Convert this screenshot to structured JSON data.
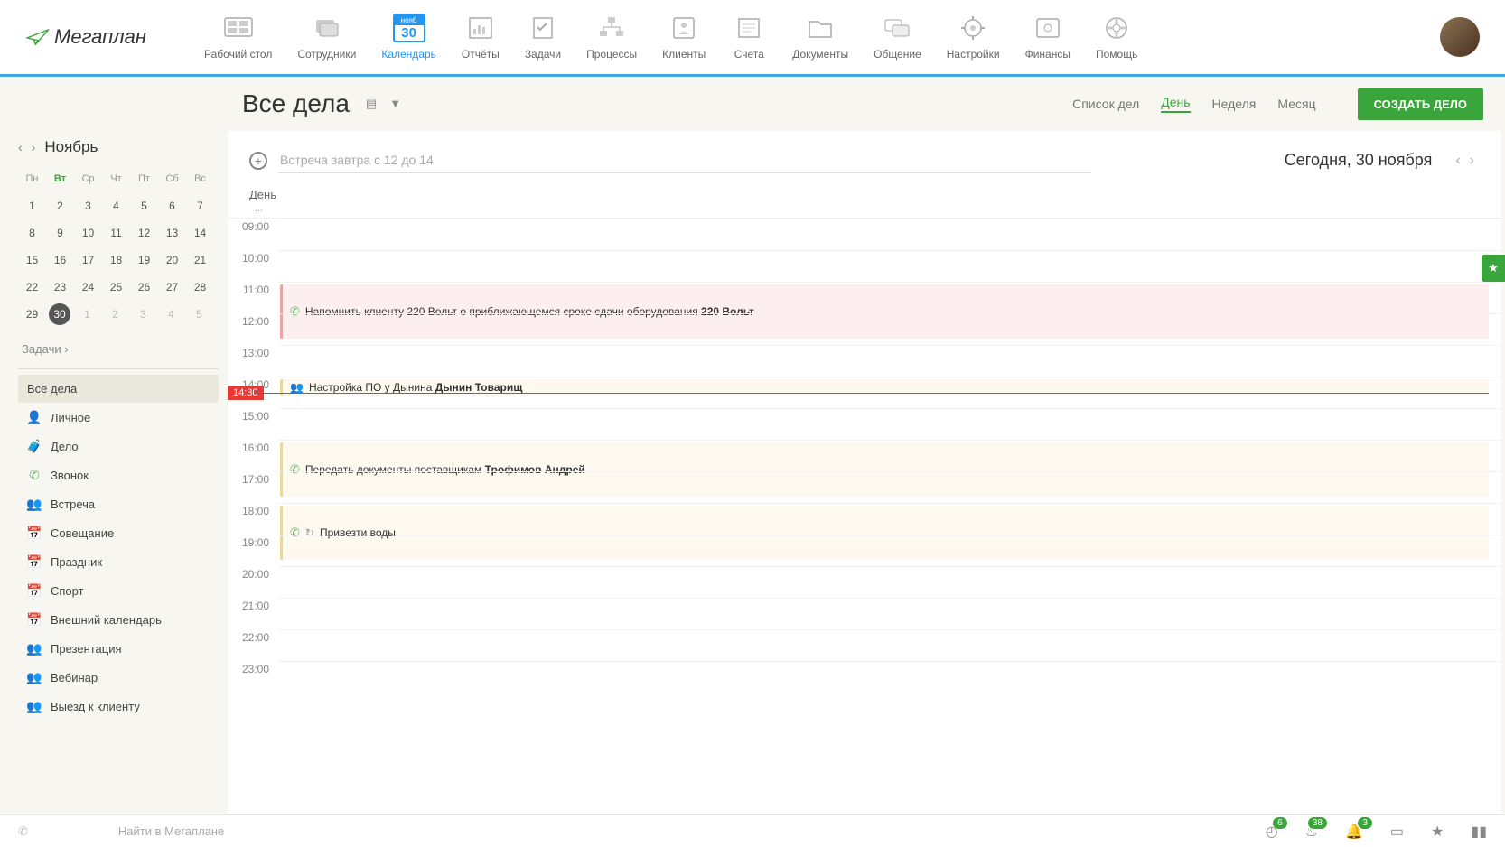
{
  "logo_text": "егаплан",
  "nav": [
    {
      "label": "Рабочий стол"
    },
    {
      "label": "Сотрудники"
    },
    {
      "label": "Календарь",
      "month_short": "нояб",
      "day_num": "30"
    },
    {
      "label": "Отчёты"
    },
    {
      "label": "Задачи"
    },
    {
      "label": "Процессы"
    },
    {
      "label": "Клиенты"
    },
    {
      "label": "Счета"
    },
    {
      "label": "Документы"
    },
    {
      "label": "Общение"
    },
    {
      "label": "Настройки"
    },
    {
      "label": "Финансы"
    },
    {
      "label": "Помощь"
    }
  ],
  "page_title": "Все дела",
  "views": {
    "list": "Список дел",
    "day": "День",
    "week": "Неделя",
    "month": "Месяц"
  },
  "create_btn": "СОЗДАТЬ ДЕЛО",
  "month_name": "Ноябрь",
  "weekdays": [
    "Пн",
    "Вт",
    "Ср",
    "Чт",
    "Пт",
    "Сб",
    "Вс"
  ],
  "mini_cal": [
    [
      "1",
      "2",
      "3",
      "4",
      "5",
      "6",
      "7"
    ],
    [
      "8",
      "9",
      "10",
      "11",
      "12",
      "13",
      "14"
    ],
    [
      "15",
      "16",
      "17",
      "18",
      "19",
      "20",
      "21"
    ],
    [
      "22",
      "23",
      "24",
      "25",
      "26",
      "27",
      "28"
    ],
    [
      "29",
      "30",
      "1",
      "2",
      "3",
      "4",
      "5"
    ]
  ],
  "tasks_link": "Задачи",
  "side_items": [
    {
      "id": "all",
      "label": "Все дела",
      "color": "transparent",
      "glyph": ""
    },
    {
      "id": "personal",
      "label": "Личное",
      "color": "#555",
      "glyph": "👤"
    },
    {
      "id": "case",
      "label": "Дело",
      "color": "#333",
      "glyph": "🧳"
    },
    {
      "id": "call",
      "label": "Звонок",
      "color": "#6cb36c",
      "glyph": "✆"
    },
    {
      "id": "meeting",
      "label": "Встреча",
      "color": "#c77",
      "glyph": "👥"
    },
    {
      "id": "conf",
      "label": "Совещание",
      "color": "#2196f3",
      "glyph": "📅"
    },
    {
      "id": "holiday",
      "label": "Праздник",
      "color": "#f5a623",
      "glyph": "📅"
    },
    {
      "id": "sport",
      "label": "Спорт",
      "color": "#f5a623",
      "glyph": "📅"
    },
    {
      "id": "extcal",
      "label": "Внешний календарь",
      "color": "#999",
      "glyph": "📅"
    },
    {
      "id": "pres",
      "label": "Презентация",
      "color": "#6cb36c",
      "glyph": "👥"
    },
    {
      "id": "webinar",
      "label": "Вебинар",
      "color": "#f5a623",
      "glyph": "👥"
    },
    {
      "id": "visit",
      "label": "Выезд к клиенту",
      "color": "#c77",
      "glyph": "👥"
    }
  ],
  "add_placeholder": "Встреча завтра с 12 до 14",
  "today_label": "Сегодня, 30 ноября",
  "day_header": "День",
  "day_sub": "...",
  "hours": [
    "09:00",
    "10:00",
    "11:00",
    "12:00",
    "13:00",
    "14:00",
    "15:00",
    "16:00",
    "17:00",
    "18:00",
    "19:00",
    "20:00",
    "21:00",
    "22:00",
    "23:00"
  ],
  "now_time": "14:30",
  "events": {
    "e1": {
      "text": "Напомнить клиенту 220 Вольт о приближающемся сроке сдачи оборудования ",
      "bold": "220 Вольт"
    },
    "e2": {
      "text": "Настройка ПО у Дынина ",
      "bold": "Дынин Товарищ"
    },
    "e3": {
      "text": "Передать документы поставщикам ",
      "bold": "Трофимов Андрей"
    },
    "e4": {
      "text": "Привезти воды",
      "bold": ""
    }
  },
  "search_placeholder": "Найти в Мегаплане",
  "badges": {
    "b1": "6",
    "b2": "38",
    "b3": "3"
  }
}
